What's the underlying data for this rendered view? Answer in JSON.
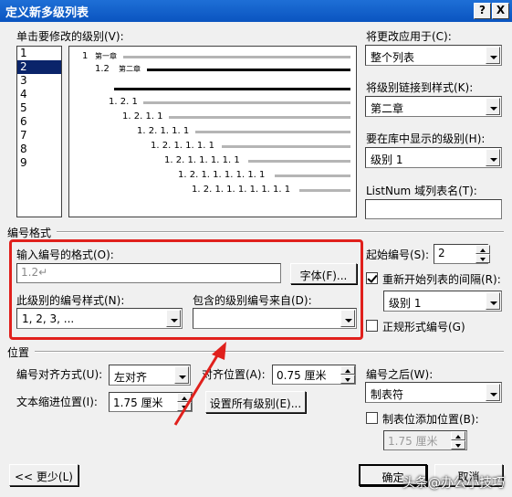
{
  "window": {
    "title": "定义新多级列表",
    "help_label": "?",
    "close_label": "X"
  },
  "levels": {
    "label": "单击要修改的级别(V):",
    "items": [
      "1",
      "2",
      "3",
      "4",
      "5",
      "6",
      "7",
      "8",
      "9"
    ],
    "selected": "2"
  },
  "preview": {
    "lines": [
      {
        "num": "1",
        "text": "第一章"
      },
      {
        "num": "1.2",
        "text": "第二章"
      },
      {
        "num": "",
        "text": ""
      },
      {
        "num": "1. 2. 1",
        "text": ""
      },
      {
        "num": "1. 2. 1. 1",
        "text": ""
      },
      {
        "num": "1. 2. 1. 1. 1",
        "text": ""
      },
      {
        "num": "1. 2. 1. 1. 1. 1",
        "text": ""
      },
      {
        "num": "1. 2. 1. 1. 1. 1. 1",
        "text": ""
      },
      {
        "num": "1. 2. 1. 1. 1. 1. 1. 1",
        "text": ""
      },
      {
        "num": "1. 2. 1. 1. 1. 1. 1. 1. 1",
        "text": ""
      }
    ]
  },
  "right": {
    "apply_label": "将更改应用于(C):",
    "apply_value": "整个列表",
    "link_label": "将级别链接到样式(K):",
    "link_value": "第二章",
    "gallery_label": "要在库中显示的级别(H):",
    "gallery_value": "级别 1",
    "listnum_label": "ListNum 域列表名(T):",
    "listnum_value": ""
  },
  "number_format": {
    "section_label": "编号格式",
    "format_label": "输入编号的格式(O):",
    "format_value": "1.2↵",
    "font_button": "字体(F)...",
    "style_label": "此级别的编号样式(N):",
    "style_value": "1, 2, 3, ...",
    "include_label": "包含的级别编号来自(D):",
    "include_value": "",
    "start_label": "起始编号(S):",
    "start_value": "2",
    "restart_label": "重新开始列表的间隔(R):",
    "restart_checked": true,
    "restart_value": "级别 1",
    "legal_label": "正规形式编号(G)",
    "legal_checked": false
  },
  "position": {
    "section_label": "位置",
    "align_label": "编号对齐方式(U):",
    "align_value": "左对齐",
    "aligned_at_label": "对齐位置(A):",
    "aligned_at_value": "0.75 厘米",
    "indent_label": "文本缩进位置(I):",
    "indent_value": "1.75 厘米",
    "set_all_button": "设置所有级别(E)...",
    "follow_label": "编号之后(W):",
    "follow_value": "制表符",
    "tab_label": "制表位添加位置(B):",
    "tab_checked": false,
    "tab_value": "1.75 厘米"
  },
  "footer": {
    "less_button": "<< 更少(L)",
    "ok_button": "确定",
    "cancel_button": "取消"
  },
  "watermark": "头条@办公小技巧",
  "colors": {
    "titlebar": "#0a54c0",
    "highlight": "#e0201c",
    "selection": "#0a246a"
  }
}
